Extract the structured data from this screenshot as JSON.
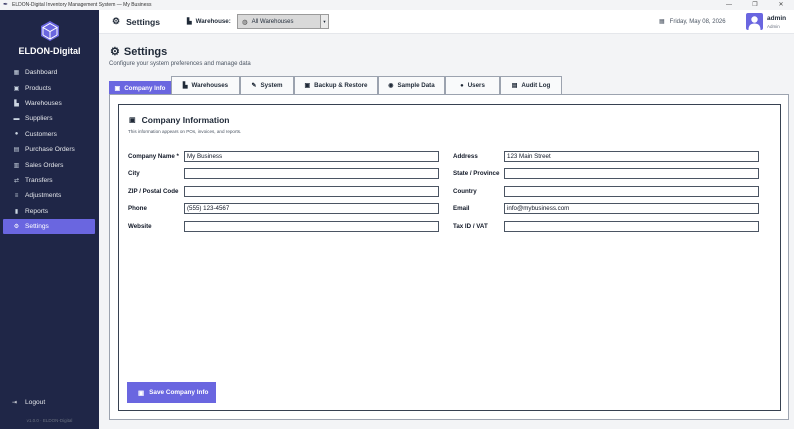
{
  "window": {
    "title": "ELDON-Digital Inventory Management System — My Business",
    "controls": [
      "—",
      "❐",
      "✕"
    ]
  },
  "sidebar": {
    "brand": "ELDON-Digital",
    "items": [
      {
        "label": "Dashboard",
        "icon": "dashboard-icon"
      },
      {
        "label": "Products",
        "icon": "box-icon"
      },
      {
        "label": "Warehouses",
        "icon": "warehouse-icon"
      },
      {
        "label": "Suppliers",
        "icon": "truck-icon"
      },
      {
        "label": "Customers",
        "icon": "users-icon"
      },
      {
        "label": "Purchase Orders",
        "icon": "clipboard-icon"
      },
      {
        "label": "Sales Orders",
        "icon": "cart-icon"
      },
      {
        "label": "Transfers",
        "icon": "transfer-icon"
      },
      {
        "label": "Adjustments",
        "icon": "sliders-icon"
      },
      {
        "label": "Reports",
        "icon": "chart-icon"
      },
      {
        "label": "Settings",
        "icon": "gear-icon",
        "active": true
      }
    ],
    "logout": "Logout",
    "version": "v1.0.0 · ELDON-Digital"
  },
  "header": {
    "title": "Settings",
    "warehouse_label": "Warehouse:",
    "warehouse_value": "All Warehouses",
    "date": "Friday, May 08, 2026",
    "user_name": "admin",
    "user_role": "Admin"
  },
  "page": {
    "title": "Settings",
    "subtitle": "Configure your system preferences and manage data"
  },
  "tabs": [
    {
      "label": "Company Info",
      "active": true
    },
    {
      "label": "Warehouses"
    },
    {
      "label": "System"
    },
    {
      "label": "Backup & Restore"
    },
    {
      "label": "Sample Data"
    },
    {
      "label": "Users"
    },
    {
      "label": "Audit Log"
    }
  ],
  "company": {
    "title": "Company Information",
    "subtitle": "This information appears on POs, invoices, and reports.",
    "fields": {
      "company_name": {
        "label": "Company Name *",
        "value": "My Business"
      },
      "address": {
        "label": "Address",
        "value": "123 Main Street"
      },
      "city": {
        "label": "City",
        "value": ""
      },
      "state": {
        "label": "State / Province",
        "value": ""
      },
      "zip": {
        "label": "ZIP / Postal Code",
        "value": ""
      },
      "country": {
        "label": "Country",
        "value": ""
      },
      "phone": {
        "label": "Phone",
        "value": "(555) 123-4567"
      },
      "email": {
        "label": "Email",
        "value": "info@mybusiness.com"
      },
      "website": {
        "label": "Website",
        "value": ""
      },
      "tax_id": {
        "label": "Tax ID / VAT",
        "value": ""
      }
    },
    "save_label": "Save Company Info"
  },
  "colors": {
    "sidebar_bg": "#1f2647",
    "accent": "#6a66e0"
  }
}
